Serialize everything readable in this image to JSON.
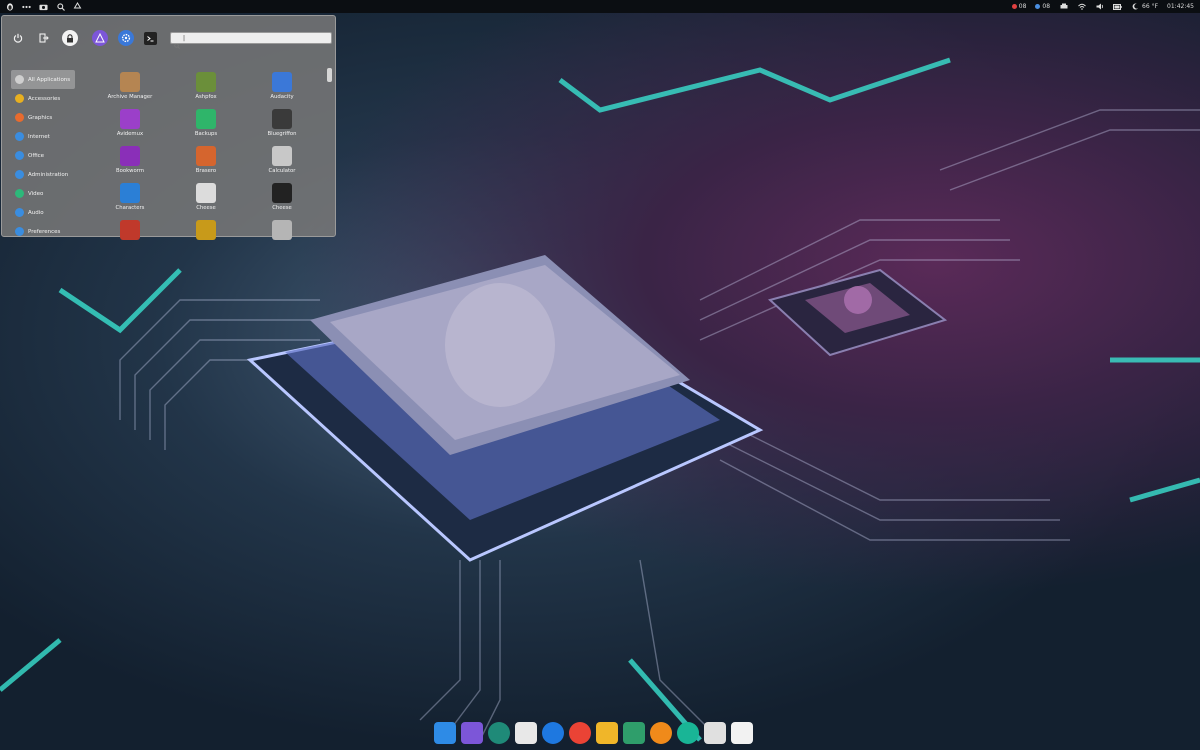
{
  "top_panel": {
    "left_icons": [
      "distro-logo-icon",
      "workspaces-icon",
      "screenshot-icon",
      "search-icon",
      "recycle-icon"
    ],
    "indicators": [
      {
        "icon": "cpu-indicator-icon",
        "value": "08",
        "color": "#e04040"
      },
      {
        "icon": "memory-indicator-icon",
        "value": "08",
        "color": "#4a8ee0"
      }
    ],
    "tray_icons": [
      "printer-icon",
      "network-icon",
      "volume-icon",
      "battery-icon"
    ],
    "weather": {
      "icon": "moon-icon",
      "text": "66 °F"
    },
    "clock": "01:42:45"
  },
  "menu": {
    "session_buttons": [
      "power-icon",
      "logout-icon",
      "lock-icon"
    ],
    "launchers": [
      "app-store-icon",
      "settings-icon",
      "terminal-icon"
    ],
    "search": {
      "value": "|",
      "placeholder": ""
    },
    "categories": [
      {
        "label": "All Applications",
        "icon": "all-apps-icon",
        "color": "#cfcfcf",
        "selected": true
      },
      {
        "label": "Accessories",
        "icon": "accessories-icon",
        "color": "#e8b020",
        "selected": false
      },
      {
        "label": "Graphics",
        "icon": "graphics-icon",
        "color": "#e86b2e",
        "selected": false
      },
      {
        "label": "Internet",
        "icon": "internet-icon",
        "color": "#3a8de0",
        "selected": false
      },
      {
        "label": "Office",
        "icon": "office-icon",
        "color": "#3a8de0",
        "selected": false
      },
      {
        "label": "Administration",
        "icon": "administration-icon",
        "color": "#3a8de0",
        "selected": false
      },
      {
        "label": "Video",
        "icon": "video-icon",
        "color": "#2db87a",
        "selected": false
      },
      {
        "label": "Audio",
        "icon": "audio-icon",
        "color": "#3a8de0",
        "selected": false
      },
      {
        "label": "Preferences",
        "icon": "preferences-icon",
        "color": "#3a8de0",
        "selected": false
      }
    ],
    "apps": [
      {
        "label": "Archive Manager",
        "icon": "archive-manager-icon",
        "color": "#b58552"
      },
      {
        "label": "Ashpfox",
        "icon": "ashpfox-icon",
        "color": "#6b8f3a"
      },
      {
        "label": "Audacity",
        "icon": "audacity-icon",
        "color": "#3b78d8"
      },
      {
        "label": "Avidemux",
        "icon": "avidemux-icon",
        "color": "#9b3fc9"
      },
      {
        "label": "Backups",
        "icon": "backups-icon",
        "color": "#2fb56a"
      },
      {
        "label": "Bluegriffon",
        "icon": "bluegriffon-icon",
        "color": "#3a3a3a"
      },
      {
        "label": "Bookworm",
        "icon": "bookworm-icon",
        "color": "#8a2fb8"
      },
      {
        "label": "Brasero",
        "icon": "brasero-icon",
        "color": "#d5652e"
      },
      {
        "label": "Calculator",
        "icon": "calculator-icon",
        "color": "#c8c8c8"
      },
      {
        "label": "Characters",
        "icon": "characters-icon",
        "color": "#2b7fd6"
      },
      {
        "label": "Cheese",
        "icon": "cheese-icon",
        "color": "#dcdcdc"
      },
      {
        "label": "Cheese",
        "icon": "subtitles-icon",
        "color": "#222222"
      },
      {
        "label": "",
        "icon": "mail-app-icon",
        "color": "#c0392b"
      },
      {
        "label": "",
        "icon": "film-app-icon",
        "color": "#c89a1a"
      },
      {
        "label": "",
        "icon": "document-app-icon",
        "color": "#b5b5b5"
      }
    ]
  },
  "dock": {
    "items": [
      {
        "icon": "files-icon",
        "color": "#2e8be6"
      },
      {
        "icon": "app-store-icon",
        "color": "#7c56d8"
      },
      {
        "icon": "web-globe-icon",
        "color": "#1f8a78"
      },
      {
        "icon": "text-editor-icon",
        "color": "#e8e8e8"
      },
      {
        "icon": "share-icon",
        "color": "#1e78e0"
      },
      {
        "icon": "chrome-icon",
        "color": "#ea4335"
      },
      {
        "icon": "mail-icon",
        "color": "#f0b629"
      },
      {
        "icon": "layers-icon",
        "color": "#2f9e6b"
      },
      {
        "icon": "firefox-icon",
        "color": "#f08a1a"
      },
      {
        "icon": "media-player-icon",
        "color": "#19b596"
      },
      {
        "icon": "speaker-icon",
        "color": "#e0e0e0"
      },
      {
        "icon": "trash-icon",
        "color": "#f2f2f2"
      }
    ]
  }
}
